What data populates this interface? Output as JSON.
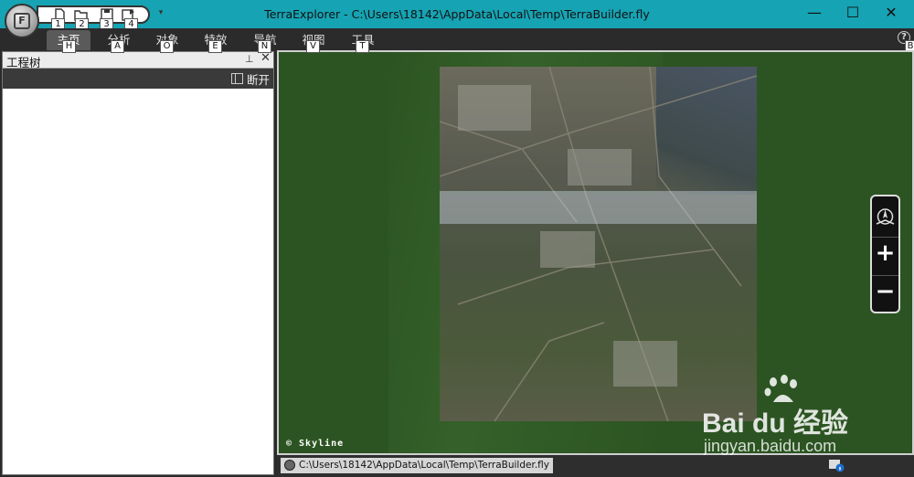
{
  "window": {
    "title": "TerraExplorer - C:\\Users\\18142\\AppData\\Local\\Temp\\TerraBuilder.fly",
    "app_button_key": "F",
    "minimize": "—",
    "maximize": "☐",
    "close": "✕"
  },
  "quick_access": {
    "keys": [
      "1",
      "2",
      "3",
      "4"
    ],
    "dropdown": "▾"
  },
  "ribbon": {
    "tabs": [
      {
        "label": "主页",
        "key": "H",
        "active": true
      },
      {
        "label": "分析",
        "key": "A"
      },
      {
        "label": "对象",
        "key": "O"
      },
      {
        "label": "特效",
        "key": "E"
      },
      {
        "label": "导航",
        "key": "N"
      },
      {
        "label": "视图",
        "key": "V"
      },
      {
        "label": "工具",
        "key": "T"
      }
    ],
    "help": "?",
    "help_key": "B"
  },
  "project_tree": {
    "title": "工程树",
    "pin": "⊥",
    "close": "✕",
    "disconnect_label": "断开"
  },
  "view": {
    "copyright": "© Skyline",
    "nav": {
      "north": "N",
      "zoom_in": "+",
      "zoom_out": "−"
    }
  },
  "statusbar": {
    "path": "C:\\Users\\18142\\AppData\\Local\\Temp\\TerraBuilder.fly"
  },
  "watermark": {
    "brand": "Bai du 经验",
    "url": "jingyan.baidu.com"
  },
  "colors": {
    "titlebar": "#16a3b3",
    "ribbon": "#2b2b2b",
    "terrain": "#2c5422"
  }
}
